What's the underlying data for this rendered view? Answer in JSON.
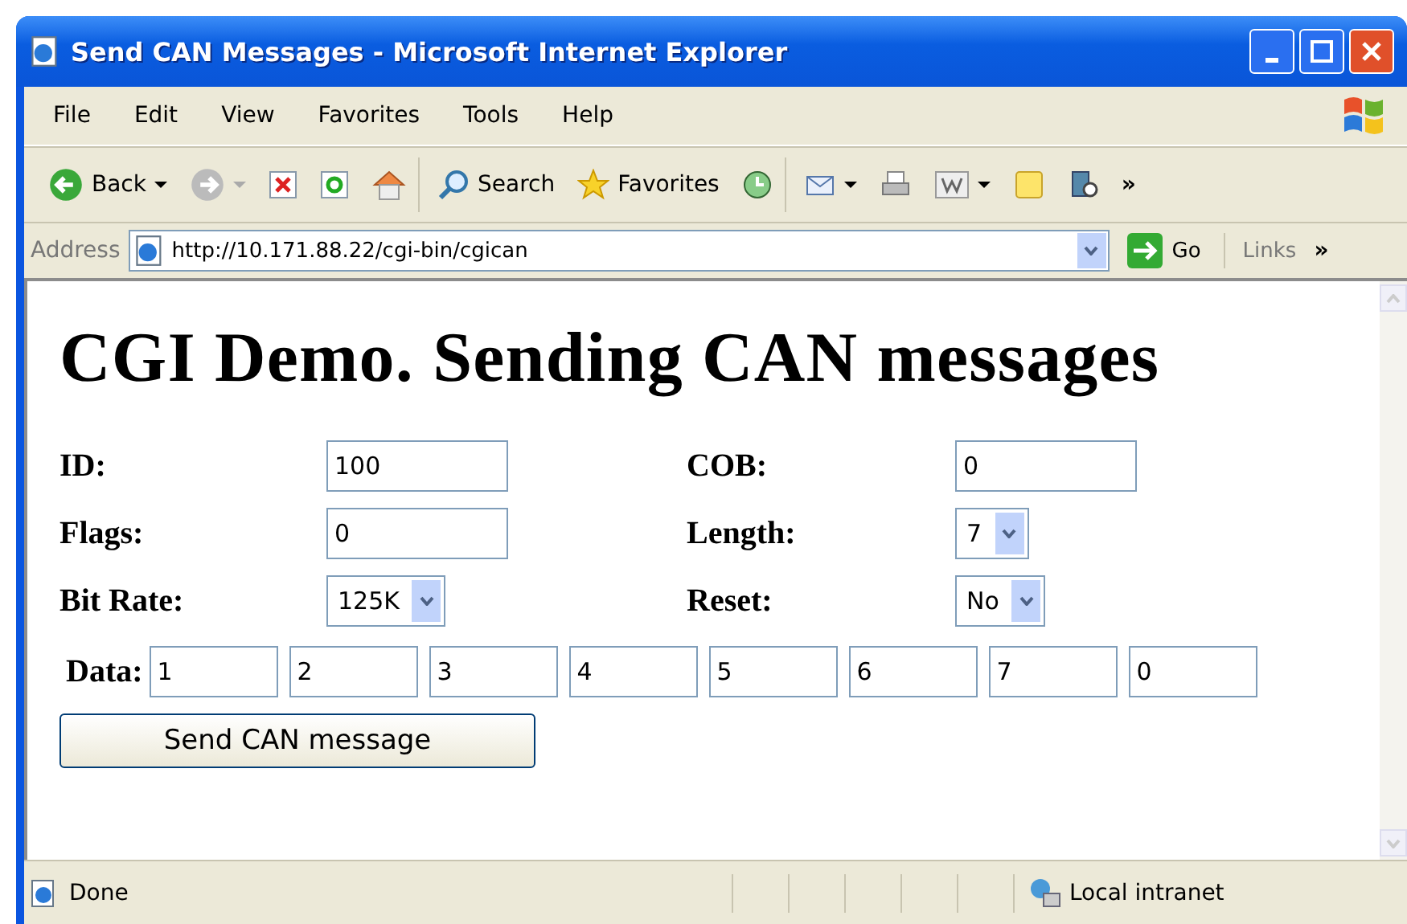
{
  "window": {
    "title": "Send CAN Messages - Microsoft Internet Explorer"
  },
  "menu": [
    "File",
    "Edit",
    "View",
    "Favorites",
    "Tools",
    "Help"
  ],
  "toolbar": [
    {
      "kind": "back",
      "label": "Back"
    },
    {
      "kind": "forward"
    },
    {
      "kind": "stop"
    },
    {
      "kind": "refresh"
    },
    {
      "kind": "home"
    },
    {
      "kind": "search",
      "label": "Search"
    },
    {
      "kind": "favorites",
      "label": "Favorites"
    },
    {
      "kind": "history"
    },
    {
      "kind": "mail"
    },
    {
      "kind": "print"
    },
    {
      "kind": "edit"
    },
    {
      "kind": "note"
    },
    {
      "kind": "research"
    }
  ],
  "toolbar_more": "»",
  "address": {
    "label": "Address",
    "url": "http://10.171.88.22/cgi-bin/cgican",
    "go": "Go",
    "links": "Links",
    "links_more": "»"
  },
  "page": {
    "heading": "CGI Demo. Sending CAN messages",
    "fields": [
      {
        "label": "ID:",
        "kind": "text",
        "value": "100"
      },
      {
        "label": "COB:",
        "kind": "text",
        "value": "0"
      },
      {
        "label": "Flags:",
        "kind": "text",
        "value": "0"
      },
      {
        "label": "Length:",
        "kind": "select",
        "value": "7"
      },
      {
        "label": "Bit Rate:",
        "kind": "select",
        "value": "125K"
      },
      {
        "label": "Reset:",
        "kind": "select",
        "value": "No"
      }
    ],
    "data_label": "Data:",
    "data": [
      "1",
      "2",
      "3",
      "4",
      "5",
      "6",
      "7",
      "0"
    ],
    "button": "Send CAN message"
  },
  "status_bar": {
    "text": "Done",
    "zone": "Local intranet"
  }
}
